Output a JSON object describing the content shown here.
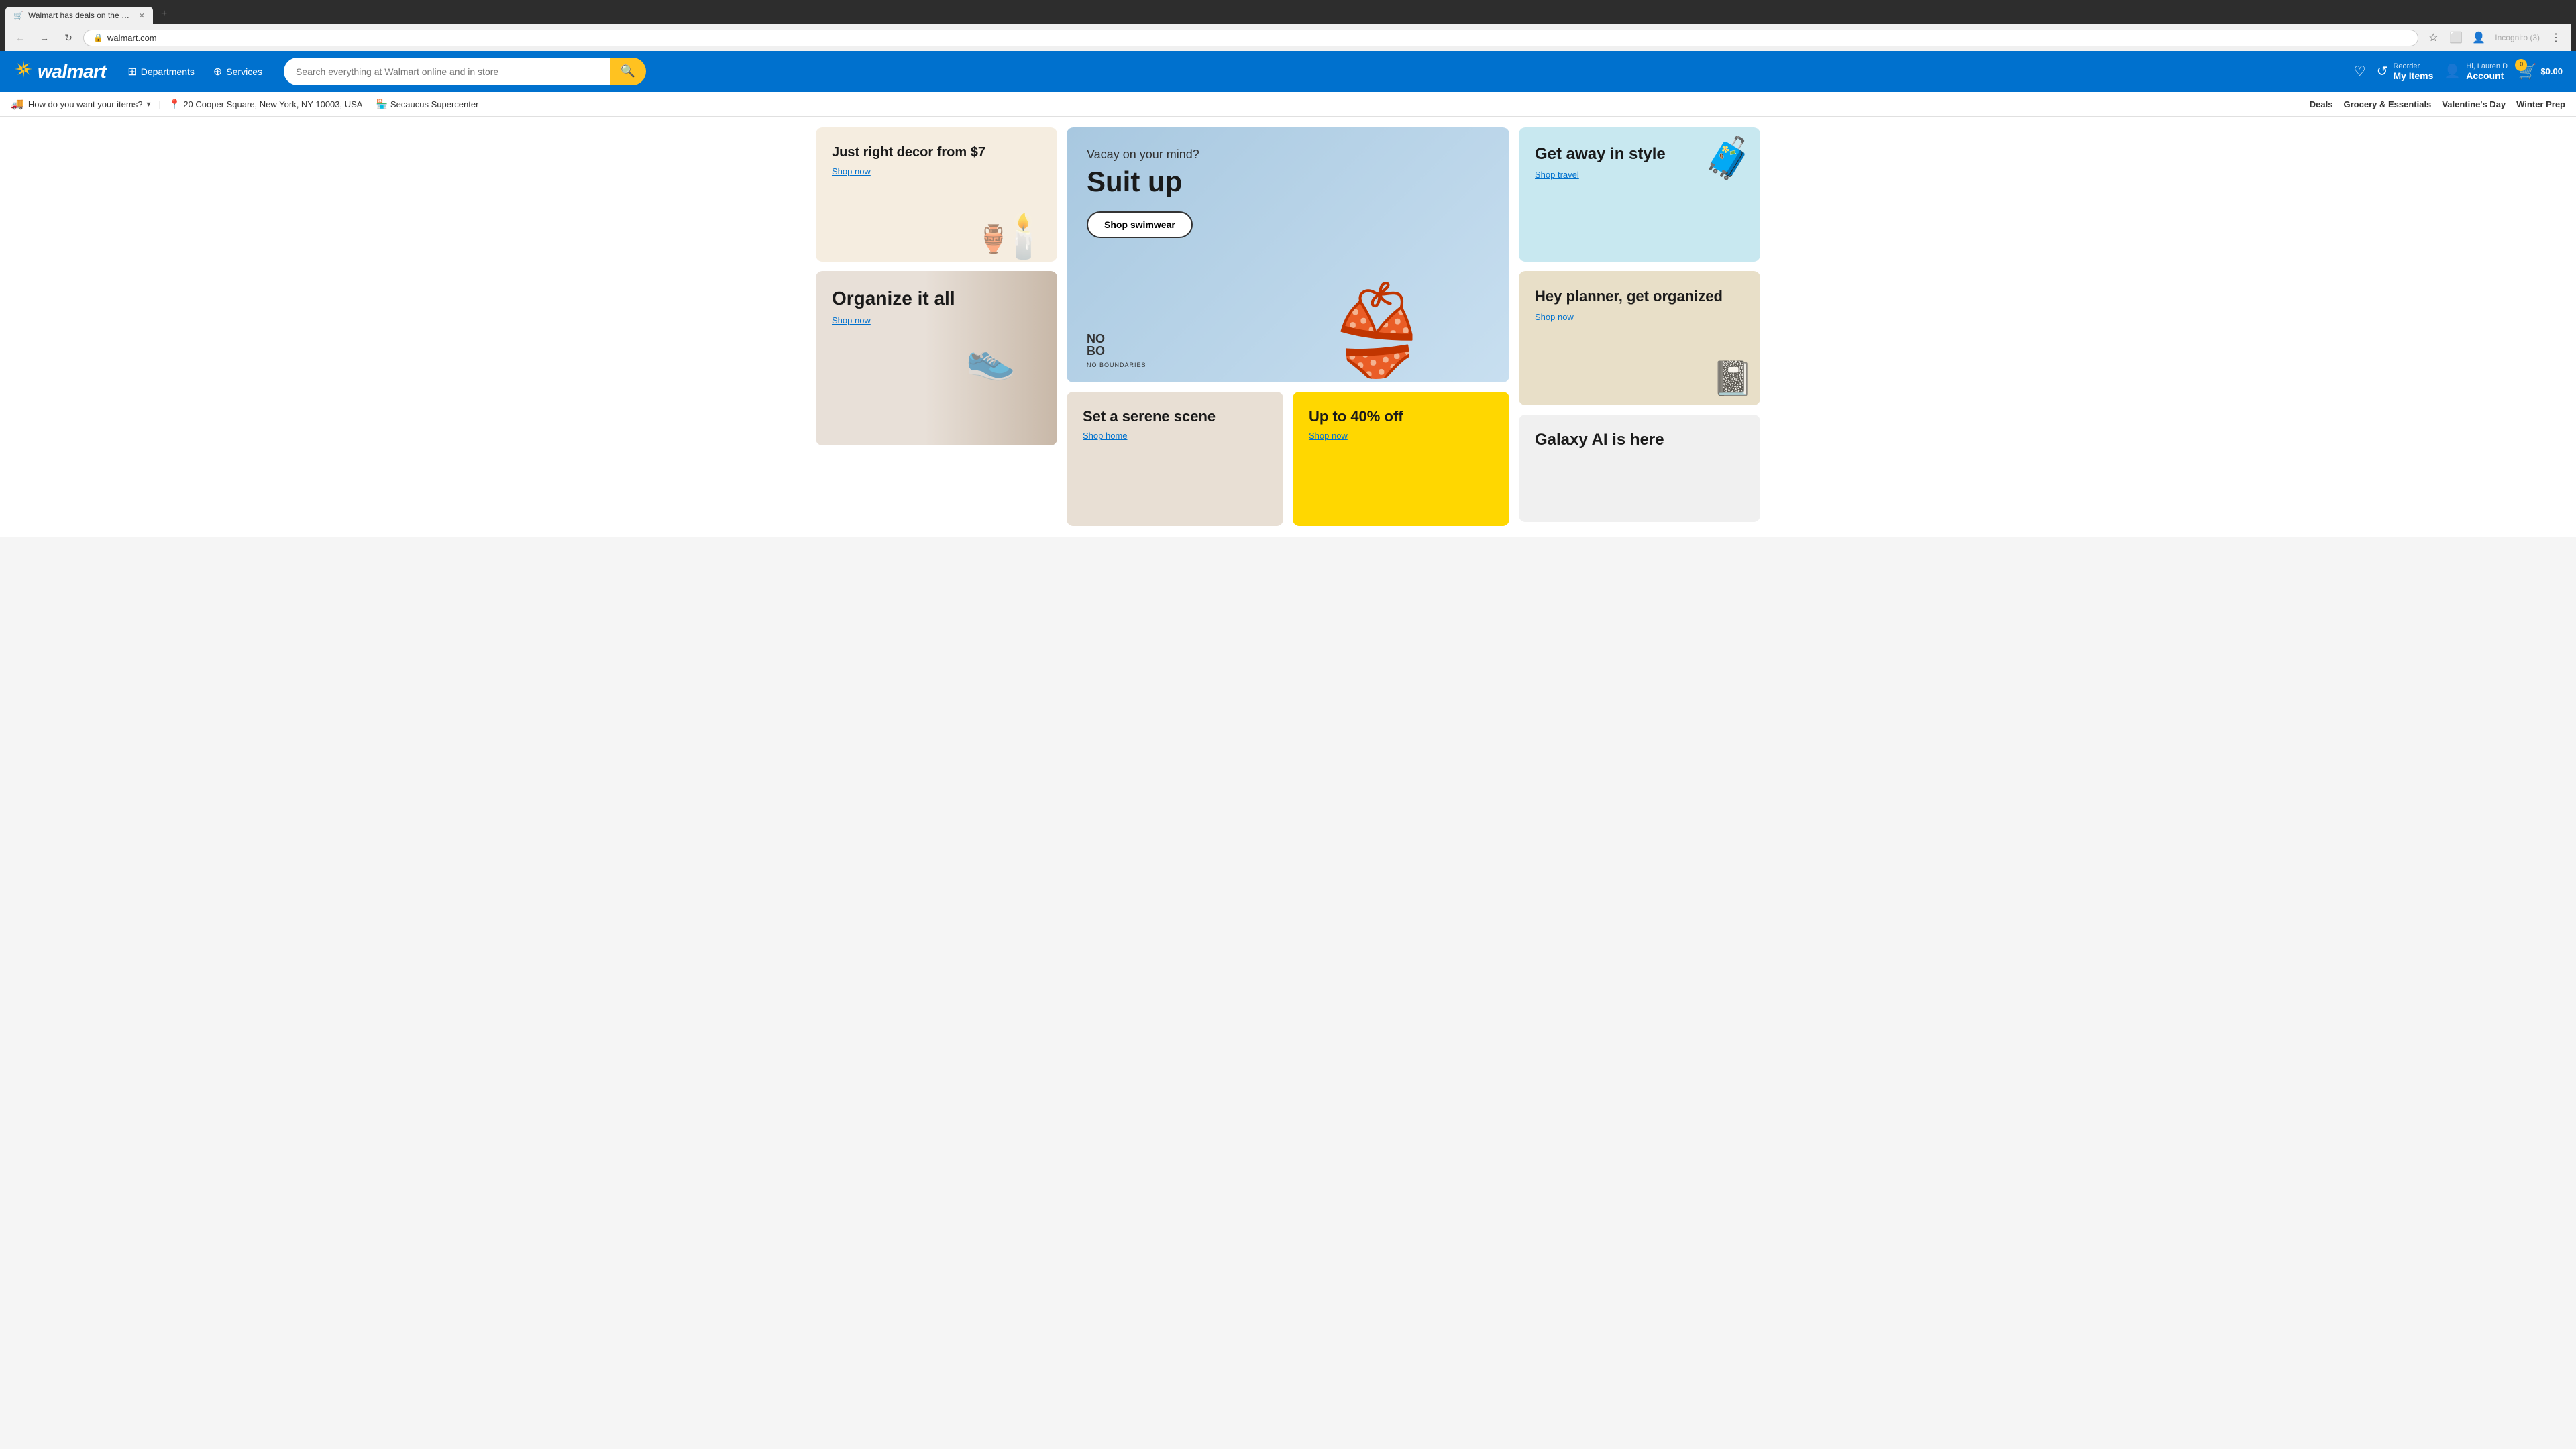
{
  "browser": {
    "tab_title": "Walmart has deals on the most...",
    "tab_favicon": "🛒",
    "url": "walmart.com",
    "incognito_label": "Incognito (3)"
  },
  "header": {
    "logo_text": "walmart",
    "departments_label": "Departments",
    "services_label": "Services",
    "search_placeholder": "Search everything at Walmart online and in store",
    "reorder_label": "Reorder",
    "my_items_label": "My Items",
    "account_greeting": "Hi, Lauren D",
    "account_label": "Account",
    "cart_count": "0",
    "cart_price": "$0.00"
  },
  "sub_nav": {
    "delivery_label": "How do you want your items?",
    "address": "20 Cooper Square, New York, NY 10003, USA",
    "store": "Secaucus Supercenter",
    "links": [
      {
        "label": "Deals",
        "id": "deals"
      },
      {
        "label": "Grocery & Essentials",
        "id": "grocery"
      },
      {
        "label": "Valentine's Day",
        "id": "valentines"
      },
      {
        "label": "Winter Prep",
        "id": "winter"
      }
    ]
  },
  "promo_cards": {
    "decor": {
      "title": "Just right decor from $7",
      "link": "Shop now"
    },
    "organize": {
      "title": "Organize it all",
      "link": "Shop now"
    },
    "hero": {
      "subtitle": "Vacay on your mind?",
      "title": "Suit up",
      "button": "Shop swimwear",
      "brand": "NO\nBO"
    },
    "travel": {
      "title": "Get away in style",
      "link": "Shop travel"
    },
    "planner": {
      "title": "Hey planner, get organized",
      "link": "Shop now"
    },
    "galaxy": {
      "title": "Galaxy AI is here"
    },
    "serene": {
      "title": "Set a serene scene",
      "link": "Shop home"
    },
    "sale": {
      "title": "Up to 40% off",
      "link": "Shop now"
    }
  },
  "colors": {
    "walmart_blue": "#0071ce",
    "walmart_yellow": "#ffc220"
  }
}
